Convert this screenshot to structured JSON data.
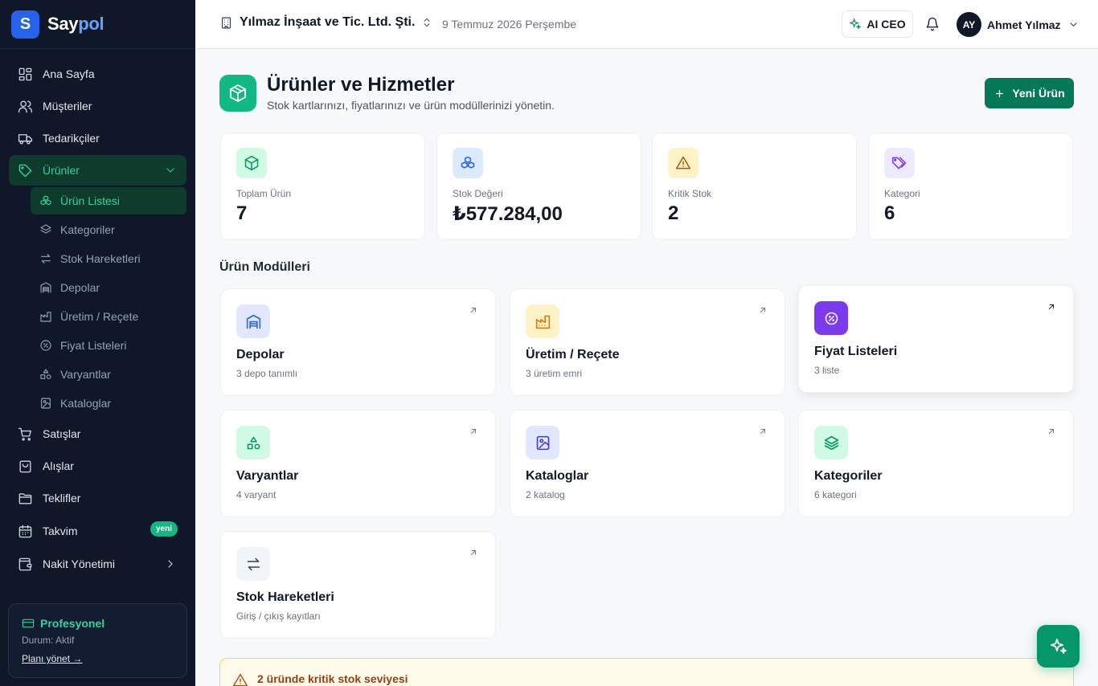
{
  "brand": {
    "initial": "S",
    "name_part1": "Say",
    "name_part2": "pol"
  },
  "sidebar": {
    "items": [
      {
        "label": "Ana Sayfa",
        "icon": "layout-grid-icon"
      },
      {
        "label": "Müşteriler",
        "icon": "users-icon"
      },
      {
        "label": "Tedarikçiler",
        "icon": "truck-icon"
      },
      {
        "label": "Ürünler",
        "icon": "tag-icon",
        "active": true,
        "expanded": true
      },
      {
        "label": "Satışlar",
        "icon": "shopping-cart-icon"
      },
      {
        "label": "Alışlar",
        "icon": "shopping-bag-icon"
      },
      {
        "label": "Teklifler",
        "icon": "folder-icon"
      },
      {
        "label": "Takvim",
        "icon": "calendar-icon",
        "badge": "yeni"
      },
      {
        "label": "Nakit Yönetimi",
        "icon": "wallet-icon"
      }
    ],
    "subitems": [
      {
        "label": "Ürün Listesi",
        "icon": "boxes-icon",
        "active": true
      },
      {
        "label": "Kategoriler",
        "icon": "layers-icon"
      },
      {
        "label": "Stok Hareketleri",
        "icon": "arrows-exchange-icon"
      },
      {
        "label": "Depolar",
        "icon": "warehouse-icon"
      },
      {
        "label": "Üretim / Reçete",
        "icon": "factory-icon"
      },
      {
        "label": "Fiyat Listeleri",
        "icon": "badge-percent-icon"
      },
      {
        "label": "Varyantlar",
        "icon": "shapes-icon"
      },
      {
        "label": "Kataloglar",
        "icon": "book-image-icon"
      }
    ],
    "plan": {
      "title": "Profesyonel",
      "status": "Durum: Aktif",
      "link": "Planı yönet →"
    }
  },
  "header": {
    "company": "Yılmaz İnşaat ve Tic. Ltd. Şti.",
    "date": "9 Temmuz 2026 Perşembe",
    "ai_label": "AI CEO",
    "user_initials": "AY",
    "user_name": "Ahmet Yılmaz"
  },
  "page": {
    "title": "Ürünler ve Hizmetler",
    "subtitle": "Stok kartlarınızı, fiyatlarınızı ve ürün modüllerinizi yönetin.",
    "new_button": "Yeni Ürün"
  },
  "stats": [
    {
      "label": "Toplam Ürün",
      "value": "7",
      "icon": "package-icon",
      "color": "#059669"
    },
    {
      "label": "Stok Değeri",
      "value": "₺577.284,00",
      "icon": "boxes-icon",
      "color": "#2563eb"
    },
    {
      "label": "Kritik Stok",
      "value": "2",
      "icon": "warning-icon",
      "color": "#b45309"
    },
    {
      "label": "Kategori",
      "value": "6",
      "icon": "tags-icon",
      "color": "#7c3aed"
    }
  ],
  "modules_title": "Ürün Modülleri",
  "modules": [
    {
      "name": "Depolar",
      "desc": "3 depo tanımlı",
      "icon": "warehouse-icon"
    },
    {
      "name": "Üretim / Reçete",
      "desc": "3 üretim emri",
      "icon": "factory-icon"
    },
    {
      "name": "Fiyat Listeleri",
      "desc": "3 liste",
      "icon": "badge-percent-icon"
    },
    {
      "name": "Varyantlar",
      "desc": "4 varyant",
      "icon": "shapes-icon"
    },
    {
      "name": "Kataloglar",
      "desc": "2 katalog",
      "icon": "book-image-icon"
    },
    {
      "name": "Kategoriler",
      "desc": "6 kategori",
      "icon": "layers-icon"
    },
    {
      "name": "Stok Hareketleri",
      "desc": "Giriş / çıkış kayıtları",
      "icon": "arrows-exchange-icon"
    }
  ],
  "alert": {
    "text": "2 üründe kritik stok seviyesi"
  },
  "colors": {
    "accent": "#059669",
    "sidebar_bg": "#0f1729",
    "brand": "#2563eb"
  }
}
